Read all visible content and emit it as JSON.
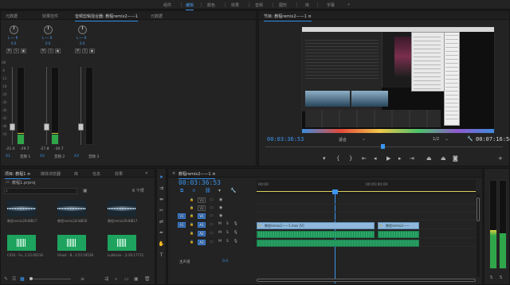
{
  "workspace_bar": {
    "items": [
      "组件",
      "编辑",
      "颜色",
      "效果",
      "音频",
      "图形",
      "库",
      "字幕"
    ],
    "active": "编辑"
  },
  "audio_panel": {
    "tabs": [
      "元数据",
      "效果控件",
      "音频剪辑混合器: 教程remix2——1",
      "元数据"
    ],
    "channels": [
      {
        "lr": "L ── R",
        "pan": "0.0",
        "val_left": "-21.0",
        "val_right": "-29.7",
        "track": "A1",
        "name": "音频 1",
        "m": "M",
        "s": "S"
      },
      {
        "lr": "L ── R",
        "pan": "0.0",
        "val_left": "-27.8",
        "val_right": "-30.7",
        "track": "A2",
        "name": "音频 2",
        "m": "M",
        "s": "S"
      },
      {
        "lr": "L ── R",
        "pan": "0.0",
        "val_left": "",
        "val_right": "",
        "track": "A3",
        "name": "音频 3",
        "m": "M",
        "s": "S"
      }
    ],
    "db_scale": [
      "dB",
      "-6",
      "-12",
      "-18",
      "-24",
      "-30",
      "-36",
      "-42",
      "-48",
      "-54"
    ]
  },
  "program_monitor": {
    "title": "节目: 教程remix2——1 ≡",
    "timecode": "00:03:36:53",
    "fit": "适合",
    "fraction": "1/2",
    "duration": "00:07:16:58"
  },
  "project_panel": {
    "tabs": [
      "项目: 教程1 ≡",
      "媒体浏览器",
      "库",
      "信息",
      "效果"
    ],
    "project_file": "教程1.prproj",
    "item_count": "6 个项",
    "search_placeholder": "",
    "items": [
      {
        "name": "教程remix2——1",
        "dur": "5:50:17"
      },
      {
        "name": "教程remix2——1",
        "dur": "2:16:56"
      },
      {
        "name": "教程remix2——1",
        "dur": "5:50:17"
      },
      {
        "name": "C416 - Fu...",
        "dur": "1:22:00216"
      },
      {
        "name": "Ghost - B...",
        "dur": "3:52:19536"
      },
      {
        "name": "Lullaisse - ...",
        "dur": "2:26:17712"
      }
    ]
  },
  "timeline": {
    "tab": "教程remix2——1 ≡",
    "timecode": "00:03:36:53",
    "ruler": [
      "00:00",
      "00:05:00:00"
    ],
    "tracks": [
      {
        "id": "V3",
        "type": "video"
      },
      {
        "id": "V2",
        "type": "video"
      },
      {
        "id": "V1",
        "type": "video",
        "source": "V1"
      },
      {
        "id": "A1",
        "type": "audio",
        "source": "A1"
      },
      {
        "id": "A2",
        "type": "audio"
      },
      {
        "id": "A3",
        "type": "audio"
      }
    ],
    "clips": {
      "v1_a": "教程remix2——1.mov [V]",
      "v1_b": "教程remix2——",
      "master": "主声道",
      "master_val": "0.0"
    },
    "track_buttons": {
      "m": "M",
      "s": "S"
    }
  },
  "colors": {
    "accent_blue": "#3c95ef",
    "audio_green": "#2aa868",
    "video_blue": "#8fb8dc"
  }
}
